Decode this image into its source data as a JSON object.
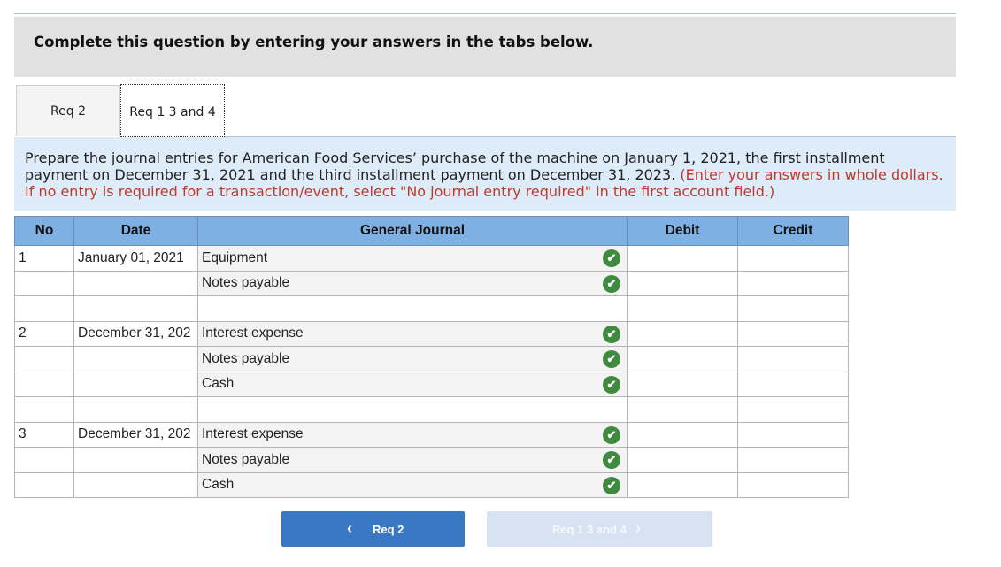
{
  "banner": {
    "text": "Complete this question by entering your answers in the tabs below."
  },
  "tabs": [
    {
      "label": "Req 2"
    },
    {
      "label": "Req 1 3 and 4"
    }
  ],
  "instructions": {
    "main": "Prepare the journal entries for American Food Services’ purchase of the machine on January 1, 2021, the first installment payment on December 31, 2021 and the third installment payment on December 31, 2023.",
    "note": "(Enter your answers in whole dollars. If no entry is required for a transaction/event, select \"No journal entry required\" in the first account field.)"
  },
  "table": {
    "headers": {
      "no": "No",
      "date": "Date",
      "gj": "General Journal",
      "debit": "Debit",
      "credit": "Credit"
    },
    "rows": [
      {
        "no": "1",
        "date": "January 01, 2021",
        "account": "Equipment",
        "check": true
      },
      {
        "no": "",
        "date": "",
        "account": "Notes payable",
        "check": true
      },
      {
        "no": "",
        "date": "",
        "account": "",
        "check": false
      },
      {
        "no": "2",
        "date": "December 31, 202",
        "account": "Interest expense",
        "check": true
      },
      {
        "no": "",
        "date": "",
        "account": "Notes payable",
        "check": true
      },
      {
        "no": "",
        "date": "",
        "account": "Cash",
        "check": true
      },
      {
        "no": "",
        "date": "",
        "account": "",
        "check": false
      },
      {
        "no": "3",
        "date": "December 31, 202",
        "account": "Interest expense",
        "check": true
      },
      {
        "no": "",
        "date": "",
        "account": "Notes payable",
        "check": true
      },
      {
        "no": "",
        "date": "",
        "account": "Cash",
        "check": true
      }
    ]
  },
  "nav": {
    "prev_label": "Req 2",
    "next_label": "Req 1 3 and 4"
  },
  "colors": {
    "header": "#7fb0e3",
    "check": "#3f8a3f",
    "prev_button": "#3a78c3",
    "next_button_disabled": "#d7e3f3",
    "note_red": "#c0392b"
  },
  "icons": {
    "check": "check-circle-icon",
    "prev": "chevron-left-icon",
    "next": "chevron-right-icon"
  }
}
